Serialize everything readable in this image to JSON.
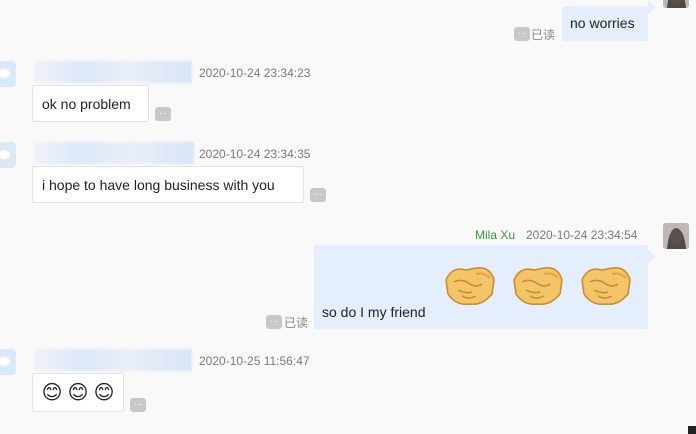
{
  "messages": [
    {
      "id": "m1",
      "text": "no worries",
      "read_label": "已读"
    },
    {
      "id": "m2",
      "timestamp": "2020-10-24 23:34:23",
      "text": "ok no problem"
    },
    {
      "id": "m3",
      "timestamp": "2020-10-24 23:34:35",
      "text": "i hope to have long business with you"
    },
    {
      "id": "m4",
      "sender": "Mila Xu",
      "timestamp": "2020-10-24 23:34:54",
      "text": "so do I my friend",
      "read_label": "已读",
      "emoji_count": 3
    },
    {
      "id": "m5",
      "timestamp": "2020-10-25 11:56:47",
      "emojis": [
        "😊",
        "😊",
        "😊"
      ]
    }
  ],
  "ui": {
    "more_glyph": "...",
    "colors": {
      "own_bubble": "#e4eefc",
      "sender_name": "#3a9a3a",
      "read_label": "#888888"
    },
    "icons": {
      "more": "more-icon",
      "handshake": "handshake-emoji"
    }
  }
}
